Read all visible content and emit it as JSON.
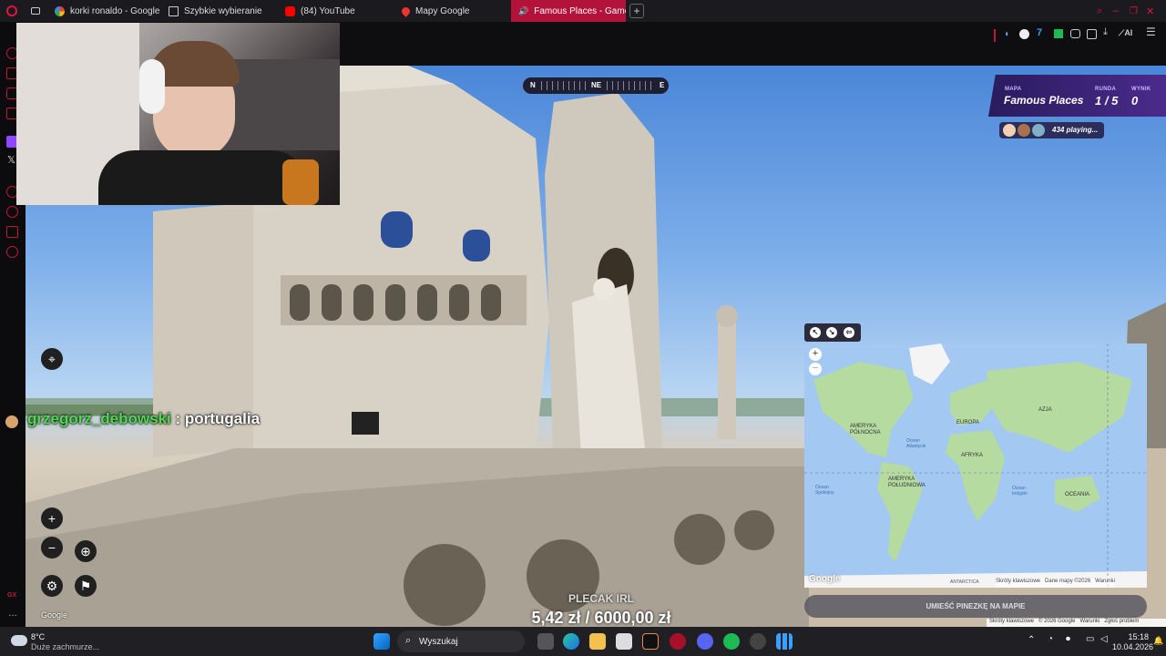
{
  "browser": {
    "tabs": [
      {
        "label": "korki ronaldo - Google Sea",
        "favicon": "google-icon",
        "active": false
      },
      {
        "label": "Szybkie wybieranie",
        "favicon": "speed-dial-icon",
        "active": false
      },
      {
        "label": "(84) YouTube",
        "favicon": "youtube-icon",
        "active": false
      },
      {
        "label": "Mapy Google",
        "favicon": "maps-pin-icon",
        "active": false
      },
      {
        "label": "Famous Places - Game",
        "favicon": "speaker-icon",
        "active": true
      }
    ],
    "new_tab": "+",
    "toolbar_ai_label": "AI"
  },
  "overlay": {
    "chat_user": "grzegorz_debowski",
    "chat_sep": ":",
    "chat_message": "portugalia",
    "donation_title": "PLECAK IRL",
    "donation_amount": "5,42 zł / 6000,00 zł"
  },
  "game": {
    "compass_labels": [
      "N",
      "NE",
      "E"
    ],
    "map_label": "MAPA",
    "map_value": "Famous Places",
    "round_label": "RUNDA",
    "round_value": "1 / 5",
    "score_label": "WYNIK",
    "score_value": "0",
    "players_text": "434 playing...",
    "place_pin_button": "UMIEŚĆ PINEZKĘ NA MAPIE",
    "google_logo": "Google"
  },
  "map": {
    "labels": {
      "na": "AMERYKA PÓŁNOCNA",
      "sa": "AMERYKA POŁUDNIOWA",
      "eu": "EUROPA",
      "af": "AFRYKA",
      "as": "AZJA",
      "oc": "OCEANIA",
      "an": "ANTARCTICA",
      "atl": "Ocean Atlantycki",
      "pac": "Ocean Spokojny",
      "ind": "Ocean Indyjski"
    },
    "footer": [
      "Skróty klawiszowe",
      "Dane mapy ©2026",
      "Warunki"
    ],
    "zoom_in": "+",
    "zoom_out": "−",
    "google": "Google"
  },
  "bottom_bar": [
    "Skróty klawiszowe",
    "© 2026 Google",
    "Warunki",
    "Zgłoś problem"
  ],
  "taskbar": {
    "weather_temp": "8°C",
    "weather_desc": "Duże zachmurze...",
    "search_placeholder": "Wyszukaj",
    "time": "15:18",
    "date": "10.04.2026"
  }
}
